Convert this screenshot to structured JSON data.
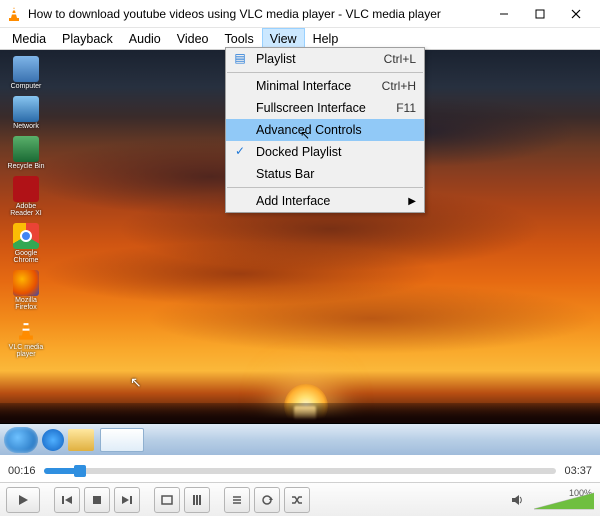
{
  "window": {
    "title": "How to download youtube videos using VLC media player - VLC media player"
  },
  "menubar": {
    "items": [
      "Media",
      "Playback",
      "Audio",
      "Video",
      "Tools",
      "View",
      "Help"
    ],
    "open_index": 5
  },
  "view_menu": {
    "items": [
      {
        "label": "Playlist",
        "shortcut": "Ctrl+L",
        "icon": "playlist"
      },
      {
        "sep": true
      },
      {
        "label": "Minimal Interface",
        "shortcut": "Ctrl+H"
      },
      {
        "label": "Fullscreen Interface",
        "shortcut": "F11"
      },
      {
        "label": "Advanced Controls",
        "highlighted": true
      },
      {
        "label": "Docked Playlist",
        "checked": true
      },
      {
        "label": "Status Bar"
      },
      {
        "sep": true
      },
      {
        "label": "Add Interface",
        "submenu": true
      }
    ]
  },
  "desktop_icons": [
    {
      "label": "Computer",
      "name": "computer"
    },
    {
      "label": "Network",
      "name": "network"
    },
    {
      "label": "Recycle Bin",
      "name": "recycle"
    },
    {
      "label": "Adobe Reader XI",
      "name": "adobe"
    },
    {
      "label": "Google Chrome",
      "name": "chrome"
    },
    {
      "label": "Mozilla Firefox",
      "name": "firefox"
    },
    {
      "label": "VLC media player",
      "name": "vlc"
    }
  ],
  "playback": {
    "elapsed": "00:16",
    "total": "03:37",
    "progress_percent": 7.2,
    "volume_percent": "100%"
  }
}
